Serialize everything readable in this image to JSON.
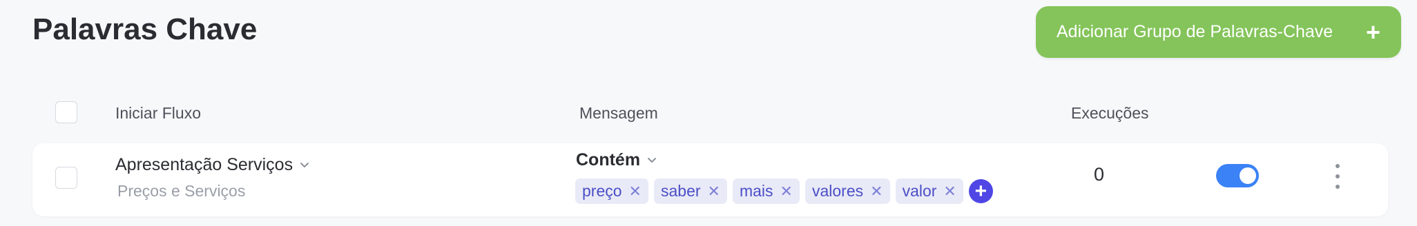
{
  "page": {
    "title": "Palavras Chave"
  },
  "add_group_button": {
    "label": "Adicionar Grupo de Palavras-Chave",
    "icon": "plus-icon"
  },
  "columns": {
    "flow": "Iniciar Fluxo",
    "message": "Mensagem",
    "executions": "Execuções"
  },
  "rows": [
    {
      "flow_name": "Apresentação Serviços",
      "flow_subtitle": "Preços e Serviços",
      "condition": "Contém",
      "keywords": [
        "preço",
        "saber",
        "mais",
        "valores",
        "valor"
      ],
      "executions": "0",
      "enabled": true
    }
  ],
  "colors": {
    "accent_green": "#84c45a",
    "toggle_blue": "#3b82f6",
    "tag_bg": "#e9eaf7",
    "tag_text": "#4b4fc7",
    "add_tag": "#4f46e5"
  }
}
